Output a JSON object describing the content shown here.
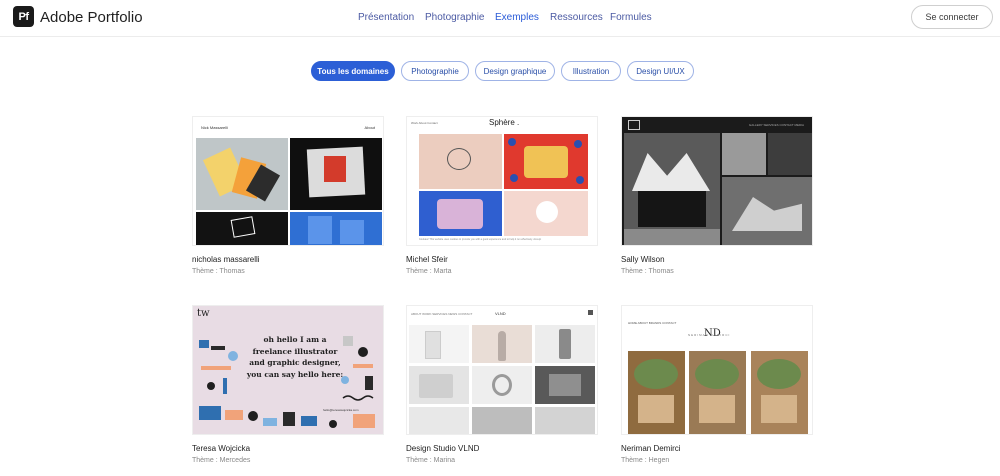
{
  "header": {
    "logo_text": "Pf",
    "brand": "Adobe Portfolio",
    "nav": [
      "Présentation",
      "Photographie",
      "Exemples",
      "Ressources",
      "Formules"
    ],
    "active_nav": "Exemples",
    "login_label": "Se connecter"
  },
  "filters": [
    "Tous les domaines",
    "Photographie",
    "Design graphique",
    "Illustration",
    "Design UI/UX"
  ],
  "active_filter": "Tous les domaines",
  "cards": [
    {
      "name": "nicholas massarelli",
      "theme": "Thème : Thomas",
      "thumb": {
        "left": "Nick Massarelli",
        "right": "About"
      }
    },
    {
      "name": "Michel Sfeir",
      "theme": "Thème : Marta",
      "thumb": {
        "title": "Sphère .",
        "menu": "Work   About   Contact",
        "cookie": "Cookies! This website uses cookies to provide you with a good experience and to help it run effectively. Accept"
      }
    },
    {
      "name": "Sally Wilson",
      "theme": "Thème : Thomas",
      "thumb": {
        "menu": "GALLERY   SERVICES   CONTACT   MEDIA"
      }
    },
    {
      "name": "Teresa Wojcicka",
      "theme": "Thème : Mercedes",
      "thumb": {
        "logo": "tw",
        "message": "oh hello I am a freelance illustrator and graphic designer, you can say hello here:",
        "email": "hello@teresawojcicka.com"
      }
    },
    {
      "name": "Design Studio VLND",
      "theme": "Thème : Marina",
      "thumb": {
        "menu": "ABOUT   WORK   SERVICES   NEWS   CONTACT",
        "logo": "VLND"
      }
    },
    {
      "name": "Neriman Demirci",
      "theme": "Thème : Hegen",
      "thumb": {
        "menu": "HOME   ABOUT   BRANDS   CONTACT",
        "logo": "ND",
        "subtitle": "NERIMAN   DEMIRCI"
      }
    }
  ],
  "colors": {
    "accent": "#2c5fd6",
    "nav": "#4b5aa3",
    "text": "#222222",
    "muted": "#888888"
  }
}
